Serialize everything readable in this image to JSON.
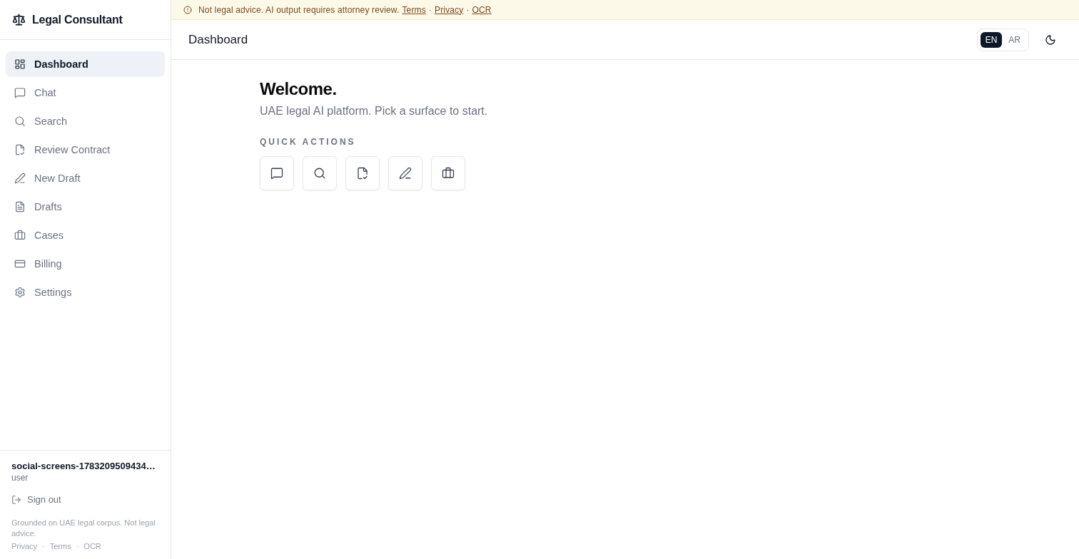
{
  "banner": {
    "text": "Not legal advice. AI output requires attorney review.",
    "links": [
      "Terms",
      "Privacy",
      "OCR"
    ],
    "separator": "·"
  },
  "sidebar": {
    "brand": "Legal Consultant",
    "items": [
      {
        "label": "Dashboard",
        "selected": true
      },
      {
        "label": "Chat",
        "selected": false
      },
      {
        "label": "Search",
        "selected": false
      },
      {
        "label": "Review Contract",
        "selected": false
      },
      {
        "label": "New Draft",
        "selected": false
      },
      {
        "label": "Drafts",
        "selected": false
      },
      {
        "label": "Cases",
        "selected": false
      },
      {
        "label": "Billing",
        "selected": false
      },
      {
        "label": "Settings",
        "selected": false
      }
    ],
    "user": {
      "name": "social-screens-1783209509434…",
      "role": "user"
    },
    "sign_out": "Sign out",
    "footer_note": "Grounded on UAE legal corpus. Not legal advice.",
    "footer_links": [
      "Privacy",
      "Terms",
      "OCR"
    ],
    "footer_separator": "·"
  },
  "header": {
    "title": "Dashboard",
    "languages": [
      {
        "label": "EN",
        "selected": true
      },
      {
        "label": "AR",
        "selected": false
      }
    ]
  },
  "welcome": {
    "title": "Welcome.",
    "subtitle": "UAE legal AI platform. Pick a surface to start.",
    "quick_actions_label": "QUICK ACTIONS"
  }
}
